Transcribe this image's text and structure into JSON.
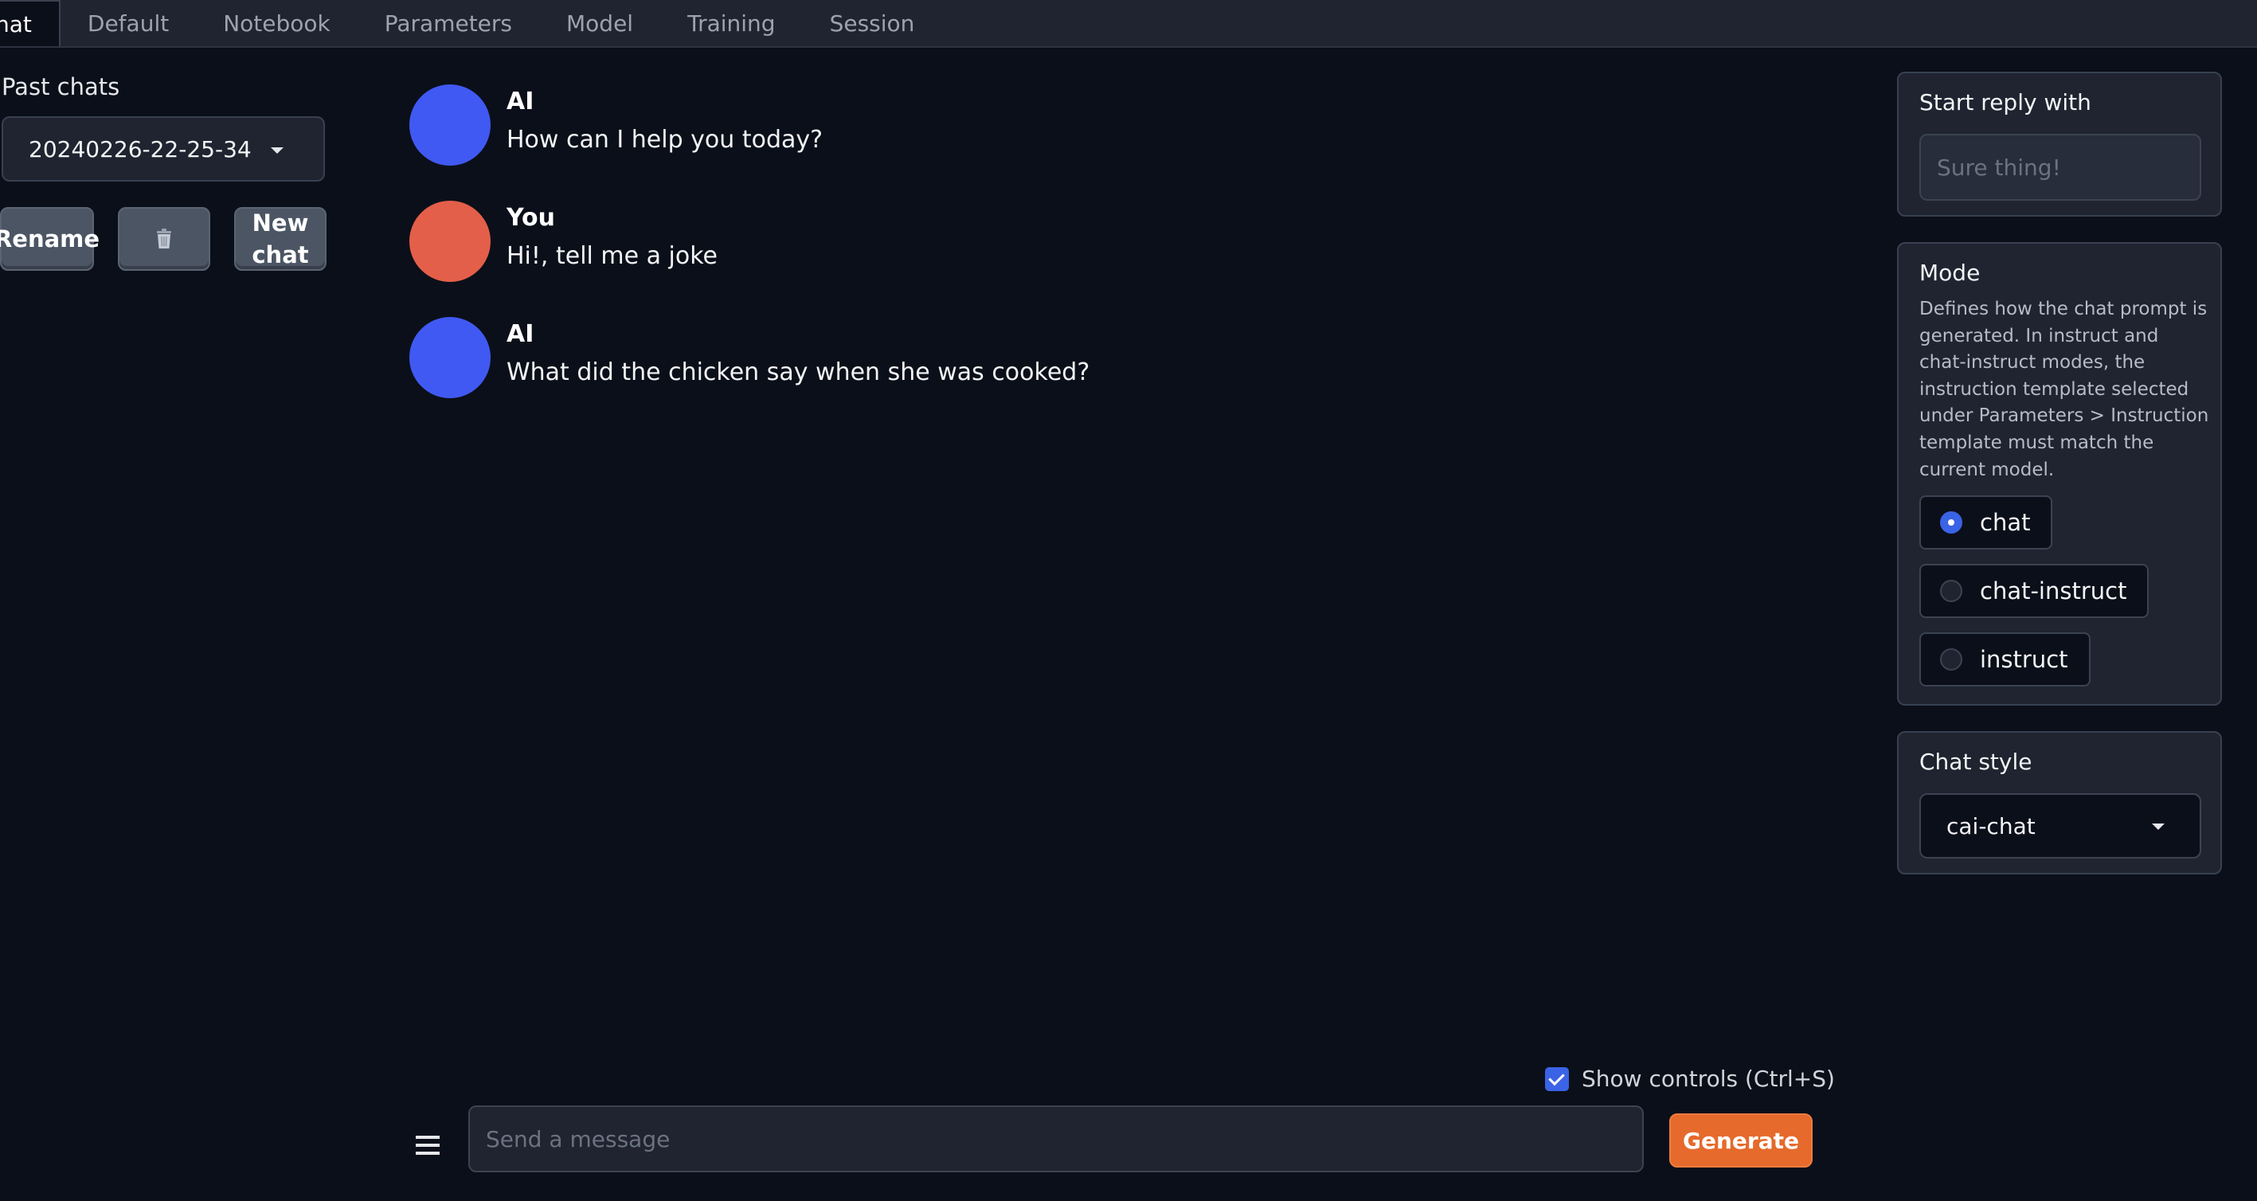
{
  "tabs": [
    {
      "label": "hat",
      "active": true
    },
    {
      "label": "Default"
    },
    {
      "label": "Notebook"
    },
    {
      "label": "Parameters"
    },
    {
      "label": "Model"
    },
    {
      "label": "Training"
    },
    {
      "label": "Session"
    }
  ],
  "sidebar": {
    "past_chats_label": "Past chats",
    "selected_chat": "20240226-22-25-34",
    "rename_label": "Rename",
    "delete_icon": "trash-icon",
    "new_chat_label_line1": "New",
    "new_chat_label_line2": "chat"
  },
  "messages": [
    {
      "sender": "AI",
      "text": "How can I help you today?",
      "avatar_color": "#4059f2"
    },
    {
      "sender": "You",
      "text": "Hi!, tell me a joke",
      "avatar_color": "#e35f4a"
    },
    {
      "sender": "AI",
      "text": "What did the chicken say when she was cooked?",
      "avatar_color": "#4059f2"
    }
  ],
  "reply": {
    "title": "Start reply with",
    "placeholder": "Sure thing!"
  },
  "mode": {
    "title": "Mode",
    "description": "Defines how the chat prompt is generated. In instruct and chat-instruct modes, the instruction template selected under Parameters > Instruction template must match the current model.",
    "options": [
      {
        "label": "chat",
        "checked": true
      },
      {
        "label": "chat-instruct",
        "checked": false
      },
      {
        "label": "instruct",
        "checked": false
      }
    ]
  },
  "chat_style": {
    "title": "Chat style",
    "value": "cai-chat"
  },
  "input": {
    "show_controls_label": "Show controls (Ctrl+S)",
    "show_controls_checked": true,
    "placeholder": "Send a message",
    "generate_label": "Generate"
  },
  "colors": {
    "background": "#0b0f19",
    "panel": "#1f2430",
    "accent": "#3b63e6",
    "generate": "#e56a2c"
  }
}
